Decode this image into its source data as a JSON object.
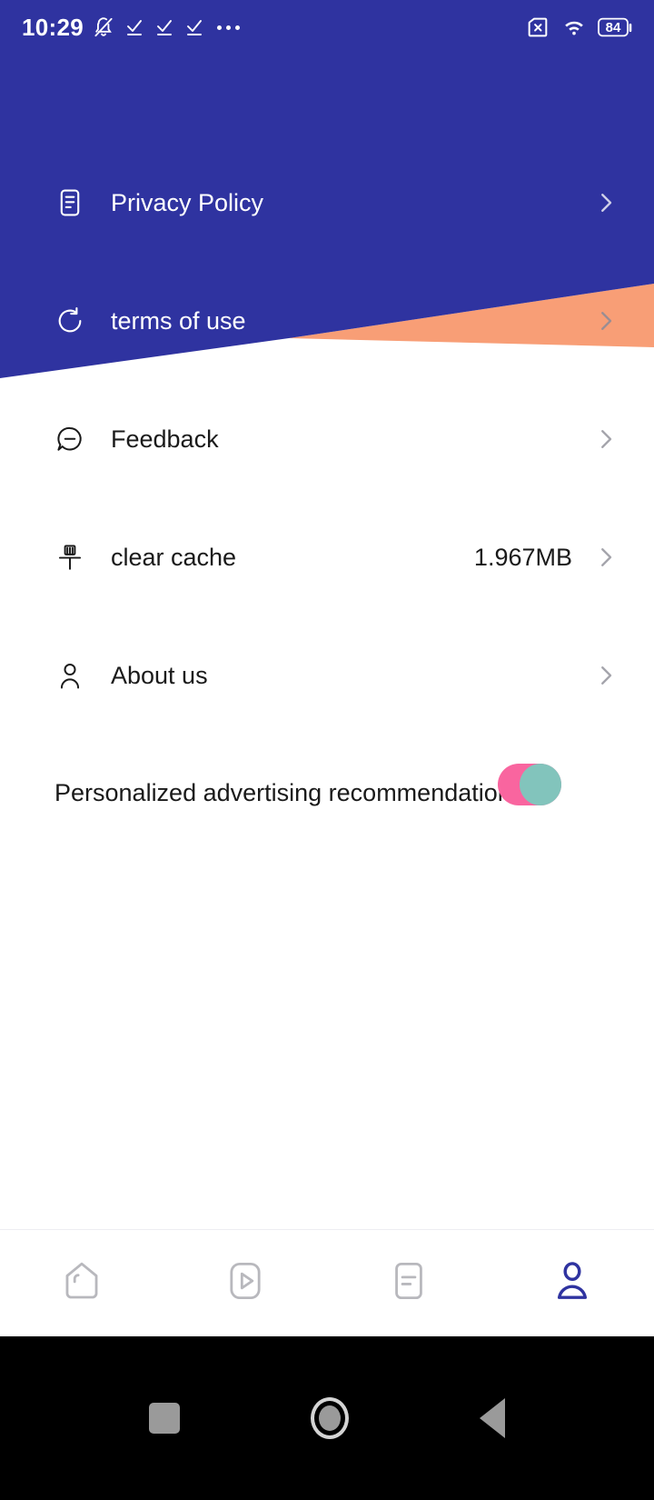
{
  "theme": {
    "primary_blue": "#2f33a0",
    "accent_orange": "#f89e76",
    "toggle_track_pink": "#f9659f",
    "toggle_knob_teal": "#82c4bc",
    "active_tab_blue": "#2f33a0",
    "inactive_tab_gray": "#b8b8bd",
    "text_dark": "#1a1a1a",
    "text_light": "#ffffff"
  },
  "statusbar": {
    "time": "10:29",
    "left_icons": [
      "bell-muted-icon",
      "check-underline-icon",
      "check-underline-icon",
      "check-underline-icon",
      "overflow-dots-icon"
    ],
    "right_icons": [
      "sim-card-disabled-icon",
      "wifi-icon",
      "battery-icon"
    ],
    "battery_level": "84"
  },
  "settings": {
    "rows": [
      {
        "id": "privacy-policy",
        "label": "Privacy Policy",
        "value": "",
        "icon": "document-lines-icon",
        "surface": "blue"
      },
      {
        "id": "terms-of-use",
        "label": "terms of use",
        "value": "",
        "icon": "refresh-circle-icon",
        "surface": "blue"
      },
      {
        "id": "feedback",
        "label": "Feedback",
        "value": "",
        "icon": "speech-bubble-icon",
        "surface": "white"
      },
      {
        "id": "clear-cache",
        "label": "clear cache",
        "value": "1.967MB",
        "icon": "broom-icon",
        "surface": "white"
      },
      {
        "id": "about-us",
        "label": "About us",
        "value": "",
        "icon": "person-icon",
        "surface": "white"
      }
    ],
    "chevron_glyph": "›"
  },
  "ad_preference": {
    "label": "Personalized advertising recommendation",
    "enabled": true,
    "state_text": "on"
  },
  "tabbar": {
    "tabs": [
      {
        "id": "home",
        "icon": "home-icon",
        "active": false
      },
      {
        "id": "video",
        "icon": "play-icon",
        "active": false
      },
      {
        "id": "feed",
        "icon": "document-icon",
        "active": false
      },
      {
        "id": "profile",
        "icon": "person-icon",
        "active": true
      }
    ]
  },
  "system_nav": {
    "buttons": [
      {
        "id": "recents",
        "icon": "square-icon"
      },
      {
        "id": "home",
        "icon": "circle-icon"
      },
      {
        "id": "back",
        "icon": "triangle-back-icon"
      }
    ]
  }
}
